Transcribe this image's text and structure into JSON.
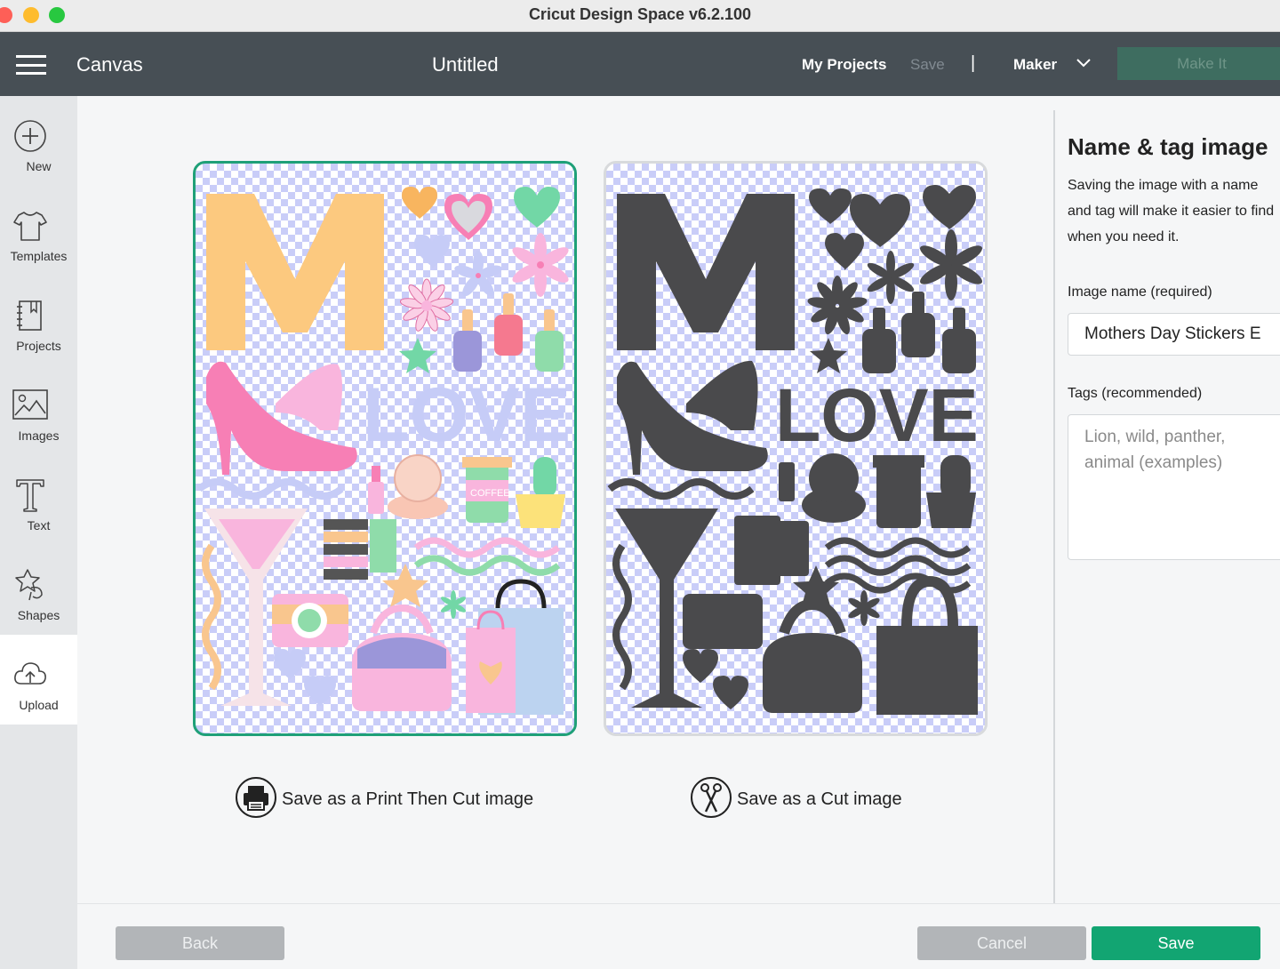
{
  "window": {
    "title": "Cricut Design Space  v6.2.100"
  },
  "header": {
    "canvas_label": "Canvas",
    "project_title": "Untitled",
    "my_projects": "My Projects",
    "save": "Save",
    "separator": "|",
    "machine": "Maker",
    "make_it": "Make It"
  },
  "sidebar": {
    "items": [
      {
        "label": "New",
        "icon": "plus-circle-icon"
      },
      {
        "label": "Templates",
        "icon": "tshirt-icon"
      },
      {
        "label": "Projects",
        "icon": "notebook-icon"
      },
      {
        "label": "Images",
        "icon": "image-icon"
      },
      {
        "label": "Text",
        "icon": "text-t-icon"
      },
      {
        "label": "Shapes",
        "icon": "shapes-icon"
      },
      {
        "label": "Upload",
        "icon": "cloud-upload-icon"
      }
    ],
    "active": "Upload"
  },
  "main": {
    "print_cut_card": {
      "artwork_text": "LOVE",
      "cup_text": "COFFEE"
    },
    "cut_card": {
      "artwork_text": "LOVE"
    },
    "print_then_cut_option": "Save as a Print Then Cut image",
    "cut_option": "Save as a Cut image",
    "selected_option": "print_then_cut"
  },
  "panel": {
    "title": "Name & tag image",
    "description": "Saving the image with a name and tag will make it easier to find when you need it.",
    "name_label": "Image name (required)",
    "name_value": "Mothers Day Stickers E",
    "tags_label": "Tags (recommended)",
    "tags_placeholder": "Lion, wild, panther, animal (examples)"
  },
  "footer": {
    "back": "Back",
    "cancel": "Cancel",
    "save": "Save"
  },
  "colors": {
    "header_bg": "#474f55",
    "accent_green": "#12a572",
    "selected_border": "#1fa078",
    "cut_fill": "#4a4a4c",
    "checker": "#c9cdf8"
  }
}
